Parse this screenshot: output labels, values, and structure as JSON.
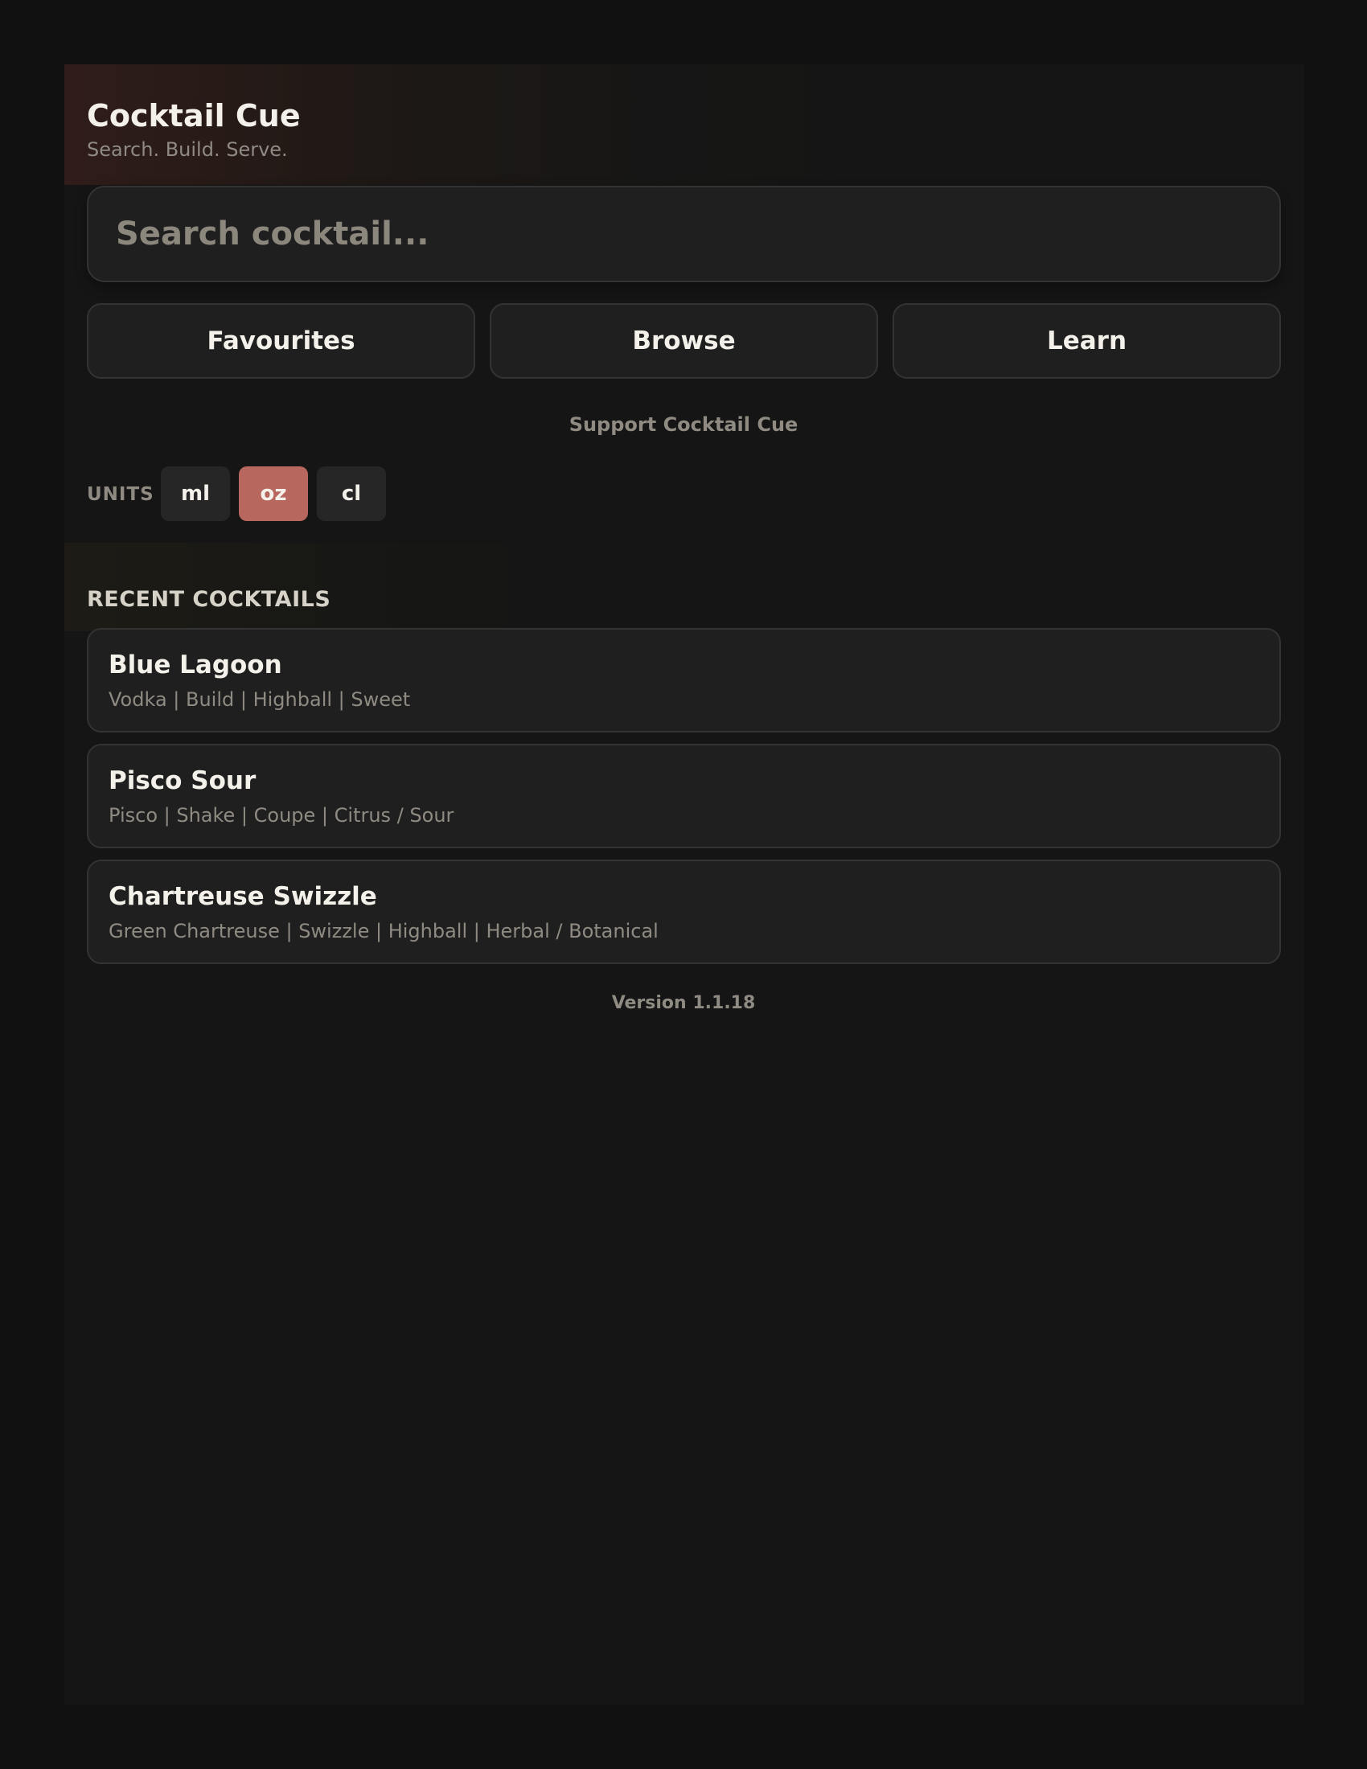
{
  "app": {
    "title": "Cocktail Cue",
    "subtitle": "Search. Build. Serve."
  },
  "search": {
    "placeholder": "Search cocktail...",
    "value": ""
  },
  "nav": {
    "favourites": "Favourites",
    "browse": "Browse",
    "learn": "Learn"
  },
  "support_label": "Support Cocktail Cue",
  "units": {
    "label": "UNITS",
    "options": [
      "ml",
      "oz",
      "cl"
    ],
    "selected": "oz"
  },
  "recent": {
    "heading": "RECENT COCKTAILS",
    "items": [
      {
        "name": "Blue Lagoon",
        "meta": "Vodka | Build | Highball | Sweet"
      },
      {
        "name": "Pisco Sour",
        "meta": "Pisco | Shake | Coupe | Citrus / Sour"
      },
      {
        "name": "Chartreuse Swizzle",
        "meta": "Green Chartreuse | Swizzle | Highball | Herbal / Botanical"
      }
    ]
  },
  "version": "Version 1.1.18",
  "colors": {
    "background": "#111111",
    "panel": "#151515",
    "card": "#1f1f1f",
    "accent_selected_unit": "#b8675f",
    "text_primary": "#f4f1ea",
    "text_muted": "#8f8b82"
  }
}
